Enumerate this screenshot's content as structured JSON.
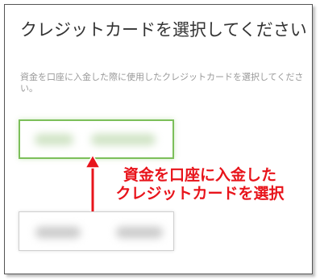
{
  "dialog": {
    "title": "クレジットカードを選択してください",
    "description": "資金を口座に入金した際に使用したクレジットカードを選択してください。"
  },
  "cards": {
    "selected": {
      "state": "selected",
      "border_color": "#7cbf5a"
    },
    "other": {
      "state": "unselected",
      "border_color": "#cfcfcf"
    }
  },
  "annotation": {
    "line1": "資金を口座に入金した",
    "line2": "クレジットカードを選択",
    "color": "#e8141b"
  }
}
